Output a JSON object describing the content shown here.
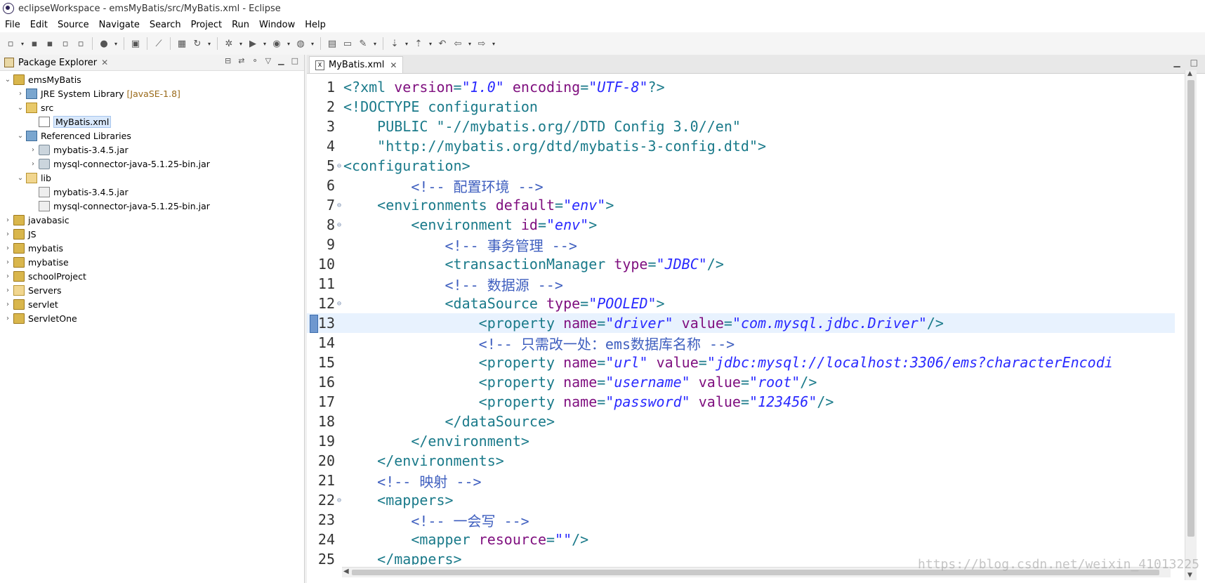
{
  "window": {
    "title": "eclipseWorkspace - emsMyBatis/src/MyBatis.xml - Eclipse"
  },
  "menu": [
    "File",
    "Edit",
    "Source",
    "Navigate",
    "Search",
    "Project",
    "Run",
    "Window",
    "Help"
  ],
  "package_explorer": {
    "title": "Package Explorer",
    "close_glyph": "✕",
    "tree": [
      {
        "level": 0,
        "expander": "⌄",
        "icon": "proj",
        "label": "emsMyBatis"
      },
      {
        "level": 1,
        "expander": "›",
        "icon": "lib",
        "label": "JRE System Library",
        "meta": "[JavaSE-1.8]"
      },
      {
        "level": 1,
        "expander": "⌄",
        "icon": "pkg",
        "label": "src"
      },
      {
        "level": 2,
        "expander": "",
        "icon": "xml",
        "label": "MyBatis.xml",
        "selected": true
      },
      {
        "level": 1,
        "expander": "⌄",
        "icon": "lib",
        "label": "Referenced Libraries"
      },
      {
        "level": 2,
        "expander": "›",
        "icon": "jar",
        "label": "mybatis-3.4.5.jar"
      },
      {
        "level": 2,
        "expander": "›",
        "icon": "jar",
        "label": "mysql-connector-java-5.1.25-bin.jar"
      },
      {
        "level": 1,
        "expander": "⌄",
        "icon": "folder",
        "label": "lib"
      },
      {
        "level": 2,
        "expander": "",
        "icon": "jarf",
        "label": "mybatis-3.4.5.jar"
      },
      {
        "level": 2,
        "expander": "",
        "icon": "jarf",
        "label": "mysql-connector-java-5.1.25-bin.jar"
      },
      {
        "level": 0,
        "expander": "›",
        "icon": "proj",
        "label": "javabasic"
      },
      {
        "level": 0,
        "expander": "›",
        "icon": "proj",
        "label": "JS"
      },
      {
        "level": 0,
        "expander": "›",
        "icon": "proj",
        "label": "mybatis"
      },
      {
        "level": 0,
        "expander": "›",
        "icon": "proj",
        "label": "mybatise"
      },
      {
        "level": 0,
        "expander": "›",
        "icon": "proj",
        "label": "schoolProject"
      },
      {
        "level": 0,
        "expander": "›",
        "icon": "folder",
        "label": "Servers"
      },
      {
        "level": 0,
        "expander": "›",
        "icon": "proj",
        "label": "servlet"
      },
      {
        "level": 0,
        "expander": "›",
        "icon": "proj",
        "label": "ServletOne"
      }
    ]
  },
  "editor": {
    "tab_label": "MyBatis.xml",
    "tab_icon_text": "X",
    "close_glyph": "✕",
    "current_line": 13,
    "lines": [
      {
        "n": 1,
        "fold": false,
        "parts": [
          [
            "tag",
            "<?xml "
          ],
          [
            "attr",
            "version"
          ],
          [
            "tag",
            "="
          ],
          [
            "val",
            "\"1.0\""
          ],
          [
            "tag",
            " "
          ],
          [
            "attr",
            "encoding"
          ],
          [
            "tag",
            "="
          ],
          [
            "val",
            "\"UTF-8\""
          ],
          [
            "tag",
            "?>"
          ]
        ]
      },
      {
        "n": 2,
        "fold": false,
        "parts": [
          [
            "tag",
            "<!DOCTYPE configuration"
          ]
        ]
      },
      {
        "n": 3,
        "fold": false,
        "parts": [
          [
            "tag",
            "    PUBLIC "
          ],
          [
            "pubid",
            "\"-//mybatis.org//DTD Config 3.0//en\""
          ]
        ]
      },
      {
        "n": 4,
        "fold": false,
        "parts": [
          [
            "pubid",
            "    \"http://mybatis.org/dtd/mybatis-3-config.dtd\""
          ],
          [
            "tag",
            ">"
          ]
        ]
      },
      {
        "n": 5,
        "fold": true,
        "parts": [
          [
            "tag",
            "<configuration>"
          ]
        ]
      },
      {
        "n": 6,
        "fold": false,
        "parts": [
          [
            "comment",
            "        <!-- 配置环境 -->"
          ]
        ]
      },
      {
        "n": 7,
        "fold": true,
        "parts": [
          [
            "tag",
            "    <environments "
          ],
          [
            "attr",
            "default"
          ],
          [
            "tag",
            "="
          ],
          [
            "val",
            "\"env\""
          ],
          [
            "tag",
            ">"
          ]
        ]
      },
      {
        "n": 8,
        "fold": true,
        "parts": [
          [
            "tag",
            "        <environment "
          ],
          [
            "attr",
            "id"
          ],
          [
            "tag",
            "="
          ],
          [
            "val",
            "\"env\""
          ],
          [
            "tag",
            ">"
          ]
        ]
      },
      {
        "n": 9,
        "fold": false,
        "parts": [
          [
            "comment",
            "            <!-- 事务管理 -->"
          ]
        ]
      },
      {
        "n": 10,
        "fold": false,
        "parts": [
          [
            "tag",
            "            <transactionManager "
          ],
          [
            "attr",
            "type"
          ],
          [
            "tag",
            "="
          ],
          [
            "val",
            "\"JDBC\""
          ],
          [
            "tag",
            "/>"
          ]
        ]
      },
      {
        "n": 11,
        "fold": false,
        "parts": [
          [
            "comment",
            "            <!-- 数据源 -->"
          ]
        ]
      },
      {
        "n": 12,
        "fold": true,
        "parts": [
          [
            "tag",
            "            <dataSource "
          ],
          [
            "attr",
            "type"
          ],
          [
            "tag",
            "="
          ],
          [
            "val",
            "\"POOLED\""
          ],
          [
            "tag",
            ">"
          ]
        ]
      },
      {
        "n": 13,
        "fold": false,
        "parts": [
          [
            "tag",
            "                <property "
          ],
          [
            "attr",
            "name"
          ],
          [
            "tag",
            "="
          ],
          [
            "val",
            "\"driver\""
          ],
          [
            "tag",
            " "
          ],
          [
            "attr",
            "value"
          ],
          [
            "tag",
            "="
          ],
          [
            "val",
            "\"com.mysql.jdbc.Driver\""
          ],
          [
            "tag",
            "/>"
          ]
        ]
      },
      {
        "n": 14,
        "fold": false,
        "parts": [
          [
            "comment",
            "                <!-- 只需改一处：ems数据库名称 -->"
          ]
        ]
      },
      {
        "n": 15,
        "fold": false,
        "parts": [
          [
            "tag",
            "                <property "
          ],
          [
            "attr",
            "name"
          ],
          [
            "tag",
            "="
          ],
          [
            "val",
            "\"url\""
          ],
          [
            "tag",
            " "
          ],
          [
            "attr",
            "value"
          ],
          [
            "tag",
            "="
          ],
          [
            "val",
            "\"jdbc:mysql://localhost:3306/ems?characterEncodi"
          ]
        ]
      },
      {
        "n": 16,
        "fold": false,
        "parts": [
          [
            "tag",
            "                <property "
          ],
          [
            "attr",
            "name"
          ],
          [
            "tag",
            "="
          ],
          [
            "val",
            "\"username\""
          ],
          [
            "tag",
            " "
          ],
          [
            "attr",
            "value"
          ],
          [
            "tag",
            "="
          ],
          [
            "val",
            "\"root\""
          ],
          [
            "tag",
            "/>"
          ]
        ]
      },
      {
        "n": 17,
        "fold": false,
        "parts": [
          [
            "tag",
            "                <property "
          ],
          [
            "attr",
            "name"
          ],
          [
            "tag",
            "="
          ],
          [
            "val",
            "\"password\""
          ],
          [
            "tag",
            " "
          ],
          [
            "attr",
            "value"
          ],
          [
            "tag",
            "="
          ],
          [
            "val",
            "\"123456\""
          ],
          [
            "tag",
            "/>"
          ]
        ]
      },
      {
        "n": 18,
        "fold": false,
        "parts": [
          [
            "tag",
            "            </dataSource>"
          ]
        ]
      },
      {
        "n": 19,
        "fold": false,
        "parts": [
          [
            "tag",
            "        </environment>"
          ]
        ]
      },
      {
        "n": 20,
        "fold": false,
        "parts": [
          [
            "tag",
            "    </environments>"
          ]
        ]
      },
      {
        "n": 21,
        "fold": false,
        "parts": [
          [
            "comment",
            "    <!-- 映射 -->"
          ]
        ]
      },
      {
        "n": 22,
        "fold": true,
        "parts": [
          [
            "tag",
            "    <mappers>"
          ]
        ]
      },
      {
        "n": 23,
        "fold": false,
        "parts": [
          [
            "comment",
            "        <!-- 一会写 -->"
          ]
        ]
      },
      {
        "n": 24,
        "fold": false,
        "parts": [
          [
            "tag",
            "        <mapper "
          ],
          [
            "attr",
            "resource"
          ],
          [
            "tag",
            "="
          ],
          [
            "val",
            "\"\""
          ],
          [
            "tag",
            "/>"
          ]
        ]
      },
      {
        "n": 25,
        "fold": false,
        "parts": [
          [
            "tag",
            "    </mappers>"
          ]
        ]
      }
    ]
  },
  "watermark": "https://blog.csdn.net/weixin_41013225",
  "colors": {
    "tag": "#1a7a8a",
    "attr": "#7f0f7f",
    "value": "#2a2aff",
    "comment": "#3f5fbf",
    "current_line": "#e8f2fe"
  }
}
